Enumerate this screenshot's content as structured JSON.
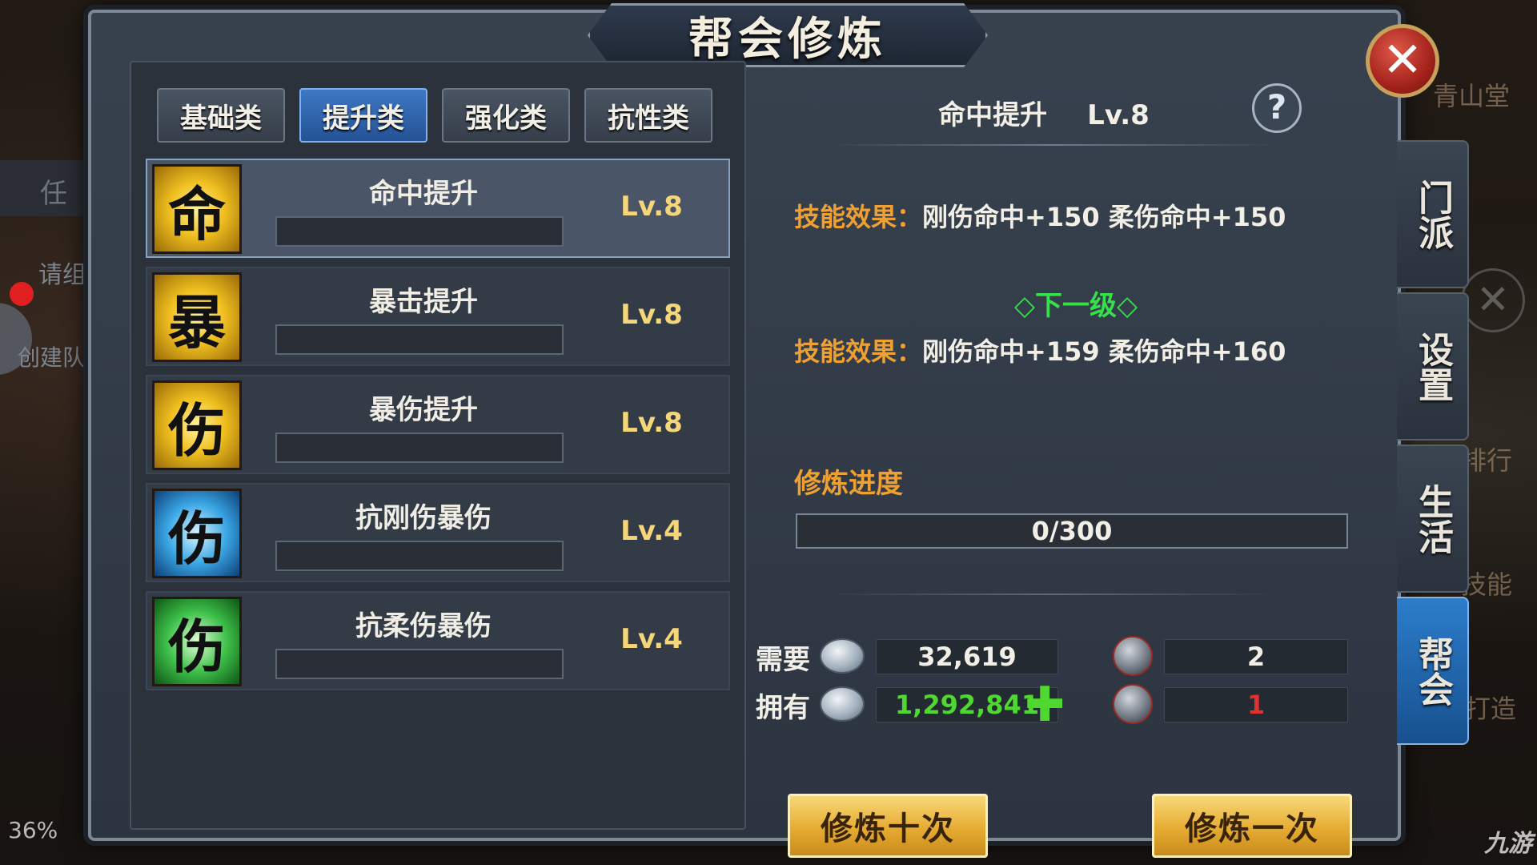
{
  "dialog": {
    "title": "帮会修炼",
    "close_symbol": "✕"
  },
  "tabs": [
    {
      "label": "基础类",
      "active": false
    },
    {
      "label": "提升类",
      "active": true
    },
    {
      "label": "强化类",
      "active": false
    },
    {
      "label": "抗性类",
      "active": false
    }
  ],
  "skills": [
    {
      "glyph": "命",
      "name": "命中提升",
      "level": "Lv.8",
      "icon": "hit-rate-icon",
      "color": "gold",
      "selected": true
    },
    {
      "glyph": "暴",
      "name": "暴击提升",
      "level": "Lv.8",
      "icon": "critical-icon",
      "color": "gold",
      "selected": false
    },
    {
      "glyph": "伤",
      "name": "暴伤提升",
      "level": "Lv.8",
      "icon": "crit-damage-icon",
      "color": "gold",
      "selected": false
    },
    {
      "glyph": "伤",
      "name": "抗刚伤暴伤",
      "level": "Lv.4",
      "icon": "resist-hard-damage-icon",
      "color": "blue",
      "selected": false
    },
    {
      "glyph": "伤",
      "name": "抗柔伤暴伤",
      "level": "Lv.4",
      "icon": "resist-soft-damage-icon",
      "color": "green",
      "selected": false
    }
  ],
  "detail": {
    "name": "命中提升",
    "level": "Lv.8",
    "help_symbol": "?",
    "effect_label": "技能效果：",
    "current_effect": "刚伤命中+150 柔伤命中+150",
    "next_level_label": "◇下一级◇",
    "next_effect": "刚伤命中+159 柔伤命中+160",
    "progress_label": "修炼进度",
    "progress_text": "0/300",
    "progress_fraction": 0
  },
  "resources": {
    "need_label": "需要",
    "have_label": "拥有",
    "need_silver": "32,619",
    "need_token": "2",
    "have_silver": "1,292,841",
    "have_token": "1",
    "plus_symbol": "✚"
  },
  "buttons": {
    "train_ten": "修炼十次",
    "train_once": "修炼一次"
  },
  "side_nav": [
    {
      "label": "门派",
      "active": false
    },
    {
      "label": "设置",
      "active": false
    },
    {
      "label": "生活",
      "active": false
    },
    {
      "label": "帮会",
      "active": true
    }
  ],
  "background": {
    "left_text_1": "任",
    "left_text_2": "请组",
    "left_text_3": "创建队",
    "percent": "36%",
    "watermark": "九游",
    "right_text_1": "青山堂",
    "right_text_2": "排行",
    "right_text_3": "技能",
    "right_text_4": "打造"
  },
  "colors": {
    "accent_blue": "#2c7dcb",
    "effect_orange": "#f0a030",
    "next_green": "#35e04a",
    "level_gold": "#f5d77a",
    "warning_red": "#e03030",
    "silver_green": "#4ed830"
  }
}
